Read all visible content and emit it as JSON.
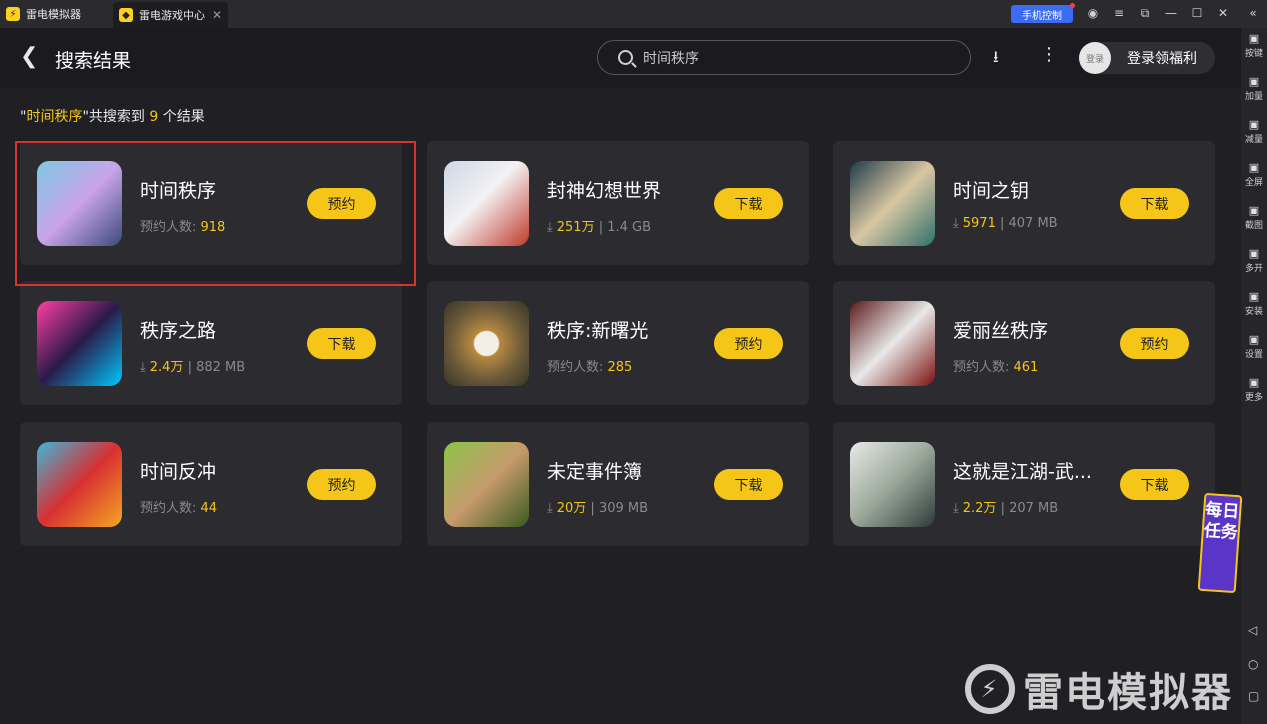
{
  "window": {
    "tab1": "雷电模拟器",
    "tab2": "雷电游戏中心",
    "phone_control": "手机控制"
  },
  "sidebar": [
    {
      "icon": "keyboard-icon",
      "label": "按键"
    },
    {
      "icon": "volume-up-icon",
      "label": "加量"
    },
    {
      "icon": "volume-down-icon",
      "label": "减量"
    },
    {
      "icon": "fullscreen-icon",
      "label": "全屏"
    },
    {
      "icon": "screenshot-icon",
      "label": "截图"
    },
    {
      "icon": "multi-open-icon",
      "label": "多开"
    },
    {
      "icon": "install-icon",
      "label": "安装"
    },
    {
      "icon": "settings-icon",
      "label": "设置"
    },
    {
      "icon": "more-icon",
      "label": "更多"
    }
  ],
  "header": {
    "title": "搜索结果",
    "search_value": "时间秩序",
    "login_avatar": "登录",
    "login_label": "登录领福利"
  },
  "result": {
    "quote_open": "\"",
    "keyword": "时间秩序",
    "quote_close": "\"",
    "mid": "共搜索到 ",
    "count": "9",
    "suffix": " 个结果"
  },
  "apps": [
    {
      "name": "时间秩序",
      "meta_label": "预约人数:",
      "value": "918",
      "size": "",
      "button": "预约"
    },
    {
      "name": "封神幻想世界",
      "meta_label": "",
      "value": "251万",
      "size": "1.4 GB",
      "button": "下载"
    },
    {
      "name": "时间之钥",
      "meta_label": "",
      "value": "5971",
      "size": "407 MB",
      "button": "下载"
    },
    {
      "name": "秩序之路",
      "meta_label": "",
      "value": "2.4万",
      "size": "882 MB",
      "button": "下载"
    },
    {
      "name": "秩序:新曙光",
      "meta_label": "预约人数:",
      "value": "285",
      "size": "",
      "button": "预约"
    },
    {
      "name": "爱丽丝秩序",
      "meta_label": "预约人数:",
      "value": "461",
      "size": "",
      "button": "预约"
    },
    {
      "name": "时间反冲",
      "meta_label": "预约人数:",
      "value": "44",
      "size": "",
      "button": "预约"
    },
    {
      "name": "未定事件簿",
      "meta_label": "",
      "value": "20万",
      "size": "309 MB",
      "button": "下载"
    },
    {
      "name": "这就是江湖-武...",
      "meta_label": "",
      "value": "2.2万",
      "size": "207 MB",
      "button": "下载"
    }
  ],
  "daily_task": "每日任务",
  "watermark": "雷电模拟器"
}
